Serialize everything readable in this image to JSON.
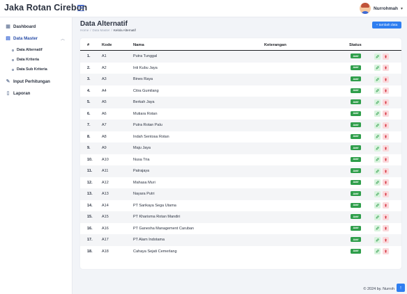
{
  "app": {
    "brand": "Jaka Rotan Cirebon"
  },
  "user": {
    "name": "Nurrohmah"
  },
  "sidebar": {
    "items": [
      {
        "label": "Dashboard"
      },
      {
        "label": "Data Master"
      },
      {
        "label": "Input Perhitungan"
      },
      {
        "label": "Laporan"
      }
    ],
    "sub_items": [
      {
        "label": "Data Alternatif"
      },
      {
        "label": "Data Kriteria"
      },
      {
        "label": "Data Sub Kriteria"
      }
    ]
  },
  "page": {
    "title": "Data Alternatif",
    "breadcrumb": [
      "Home",
      "/",
      "Data Master",
      "/",
      "Kelola Alternatif"
    ],
    "add_button": "+ tambah data"
  },
  "table": {
    "headers": {
      "no": "#",
      "kode": "Kode",
      "nama": "Nama",
      "keterangan": "Keterangan",
      "status": "Status"
    },
    "rows": [
      {
        "no": "1.",
        "kode": "A1",
        "nama": "Putra Tunggal",
        "status": "Aktif"
      },
      {
        "no": "2.",
        "kode": "A2",
        "nama": "Inti Kubu Jaya",
        "status": "Aktif"
      },
      {
        "no": "3.",
        "kode": "A3",
        "nama": "Bines Raya",
        "status": "Aktif"
      },
      {
        "no": "4.",
        "kode": "A4",
        "nama": "Citra Gumilang",
        "status": "Aktif"
      },
      {
        "no": "5.",
        "kode": "A5",
        "nama": "Berkah Jaya",
        "status": "Aktif"
      },
      {
        "no": "6.",
        "kode": "A6",
        "nama": "Mutiara Rotan",
        "status": "Aktif"
      },
      {
        "no": "7.",
        "kode": "A7",
        "nama": "Putra Rotan Palu",
        "status": "Aktif"
      },
      {
        "no": "8.",
        "kode": "A8",
        "nama": "Indah Sentosa Rotan",
        "status": "Aktif"
      },
      {
        "no": "9.",
        "kode": "A9",
        "nama": "Maju Jaya",
        "status": "Aktif"
      },
      {
        "no": "10.",
        "kode": "A10",
        "nama": "Nusa Tria",
        "status": "Aktif"
      },
      {
        "no": "11.",
        "kode": "A11",
        "nama": "Patrajaya",
        "status": "Aktif"
      },
      {
        "no": "12.",
        "kode": "A12",
        "nama": "Mahasa Muri",
        "status": "Aktif"
      },
      {
        "no": "13.",
        "kode": "A13",
        "nama": "Nayara Putri",
        "status": "Aktif"
      },
      {
        "no": "14.",
        "kode": "A14",
        "nama": "PT Sarikaya Sega Utama",
        "status": "Aktif"
      },
      {
        "no": "15.",
        "kode": "A15",
        "nama": "PT Kharisma Rotan Mandiri",
        "status": "Aktif"
      },
      {
        "no": "16.",
        "kode": "A16",
        "nama": "PT Ganesha Management Caruban",
        "status": "Aktif"
      },
      {
        "no": "17.",
        "kode": "A17",
        "nama": "PT Alam Indotama",
        "status": "Aktif"
      },
      {
        "no": "18.",
        "kode": "A18",
        "nama": "Cahaya Sejati Cemerlang",
        "status": "Aktif"
      }
    ]
  },
  "footer": {
    "text": "© 2024 by. Nurroh"
  },
  "colors": {
    "primary": "#2f7ef0",
    "active": "#2e9e4a",
    "danger": "#d6323f",
    "sidebar_active": "#3d6ad6"
  },
  "icons": [
    "menu-icon",
    "dashboard-icon",
    "folder-icon",
    "edit-icon",
    "document-icon",
    "pencil-icon",
    "trash-icon",
    "arrow-up-icon"
  ]
}
